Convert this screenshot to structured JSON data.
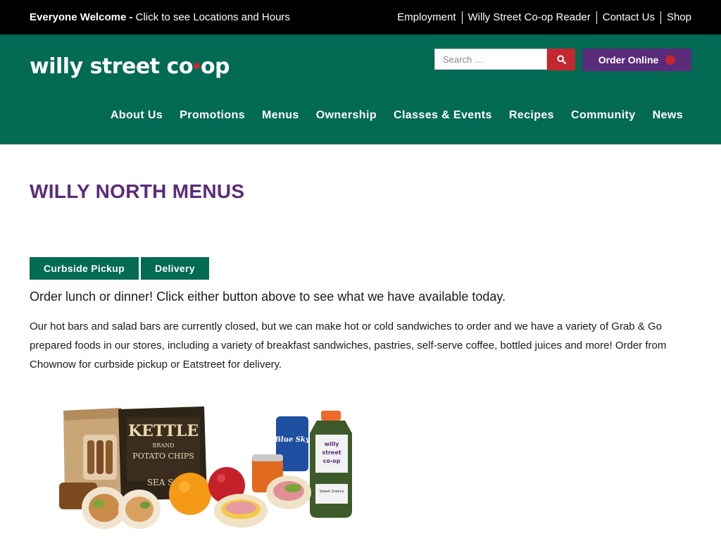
{
  "topbar": {
    "welcome_bold": "Everyone Welcome -",
    "welcome_link": "Click to see Locations and Hours",
    "links": [
      "Employment",
      "Willy Street Co-op Reader",
      "Contact Us",
      "Shop"
    ]
  },
  "header": {
    "logo_part1": "willy street co",
    "logo_part2": "op",
    "search_placeholder": "Search …",
    "search_icon": "search-icon",
    "order_label": "Order Online",
    "order_icon": "apple-icon",
    "nav": [
      "About Us",
      "Promotions",
      "Menus",
      "Ownership",
      "Classes & Events",
      "Recipes",
      "Community",
      "News"
    ]
  },
  "main": {
    "title": "WILLY NORTH MENUS",
    "buttons": [
      "Curbside Pickup",
      "Delivery"
    ],
    "lead": "Order lunch or dinner! Click either button above to see what we have available today.",
    "body": "Our hot bars and salad bars are currently closed, but we can make hot or cold sandwiches to order and we have a variety of Grab & Go prepared foods in our stores, including a variety of breakfast sandwiches, pastries, self-serve coffee, bottled juices and more! Order from Chownow for curbside pickup or Eatstreet for delivery.",
    "image": {
      "chips_brand": "KETTLE",
      "chips_sub1": "BRAND",
      "chips_sub2": "POTATO CHIPS",
      "chips_flavor": "SEA SA",
      "can_label": "Blue Sky",
      "juice_label1": "willy",
      "juice_label2": "street",
      "juice_label3": "co-op",
      "juice_name": "Sweet Greens"
    }
  },
  "colors": {
    "green": "#036a54",
    "purple": "#5b2b7b",
    "red": "#c3272f",
    "black": "#000000"
  }
}
